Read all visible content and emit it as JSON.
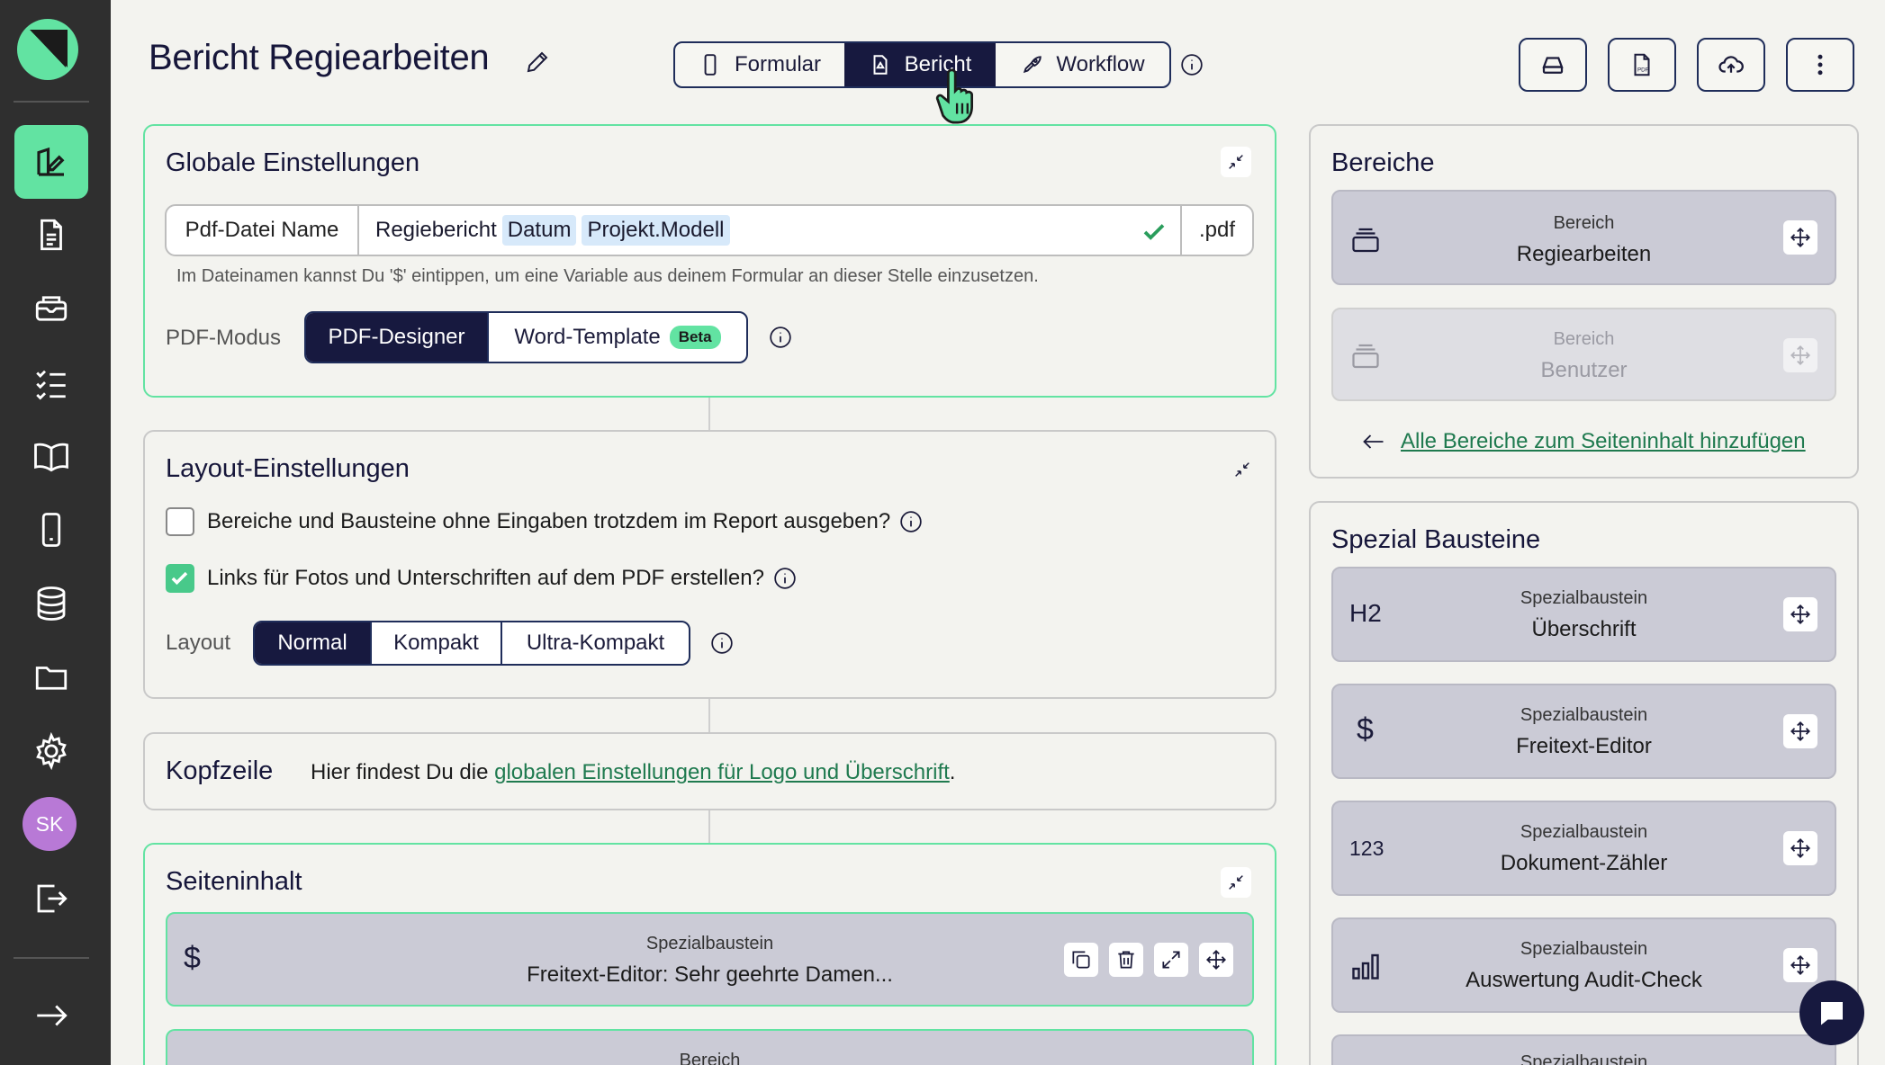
{
  "sidebar": {
    "avatar_initials": "SK",
    "items": [
      {
        "icon": "report-designer-icon",
        "active": true
      },
      {
        "icon": "document-icon"
      },
      {
        "icon": "inbox-icon"
      },
      {
        "icon": "checklist-icon"
      },
      {
        "icon": "book-icon"
      },
      {
        "icon": "phone-icon"
      },
      {
        "icon": "database-icon"
      },
      {
        "icon": "folder-icon"
      },
      {
        "icon": "gear-icon"
      },
      {
        "icon": "logout-icon"
      },
      {
        "icon": "arrow-right-icon"
      }
    ]
  },
  "header": {
    "title": "Bericht Regiearbeiten",
    "tabs": [
      {
        "label": "Formular",
        "icon": "phone-icon"
      },
      {
        "label": "Bericht",
        "icon": "pdf-file-icon",
        "active": true
      },
      {
        "label": "Workflow",
        "icon": "rocket-icon"
      }
    ],
    "actions": [
      "drive-icon",
      "pdf-icon",
      "cloud-upload-icon",
      "more-vertical-icon"
    ]
  },
  "global_settings": {
    "title": "Globale Einstellungen",
    "filename_label": "Pdf-Datei Name",
    "filename_text": "Regiebericht",
    "filename_vars": [
      "Datum",
      "Projekt.Modell"
    ],
    "filename_ext": ".pdf",
    "hint": "Im Dateinamen kannst Du '$' eintippen, um eine Variable aus deinem Formular an dieser Stelle einzusetzen.",
    "pdf_mode_label": "PDF-Modus",
    "pdf_mode_options": [
      "PDF-Designer",
      "Word-Template"
    ],
    "beta_badge": "Beta"
  },
  "layout_settings": {
    "title": "Layout-Einstellungen",
    "option1": "Bereiche und Bausteine ohne Eingaben trotzdem im Report ausgeben?",
    "option1_checked": false,
    "option2": "Links für Fotos und Unterschriften auf dem PDF erstellen?",
    "option2_checked": true,
    "layout_label": "Layout",
    "layout_options": [
      "Normal",
      "Kompakt",
      "Ultra-Kompakt"
    ]
  },
  "header_section": {
    "title": "Kopfzeile",
    "text_before": "Hier findest Du die",
    "link": "globalen Einstellungen für Logo und Überschrift",
    "text_after": "."
  },
  "page_content": {
    "title": "Seiteninhalt",
    "items": [
      {
        "type": "Spezialbaustein",
        "name": "Freitext-Editor: Sehr geehrte Damen...",
        "icon": "$"
      },
      {
        "type": "Bereich",
        "name": ""
      }
    ]
  },
  "areas": {
    "title": "Bereiche",
    "items": [
      {
        "type": "Bereich",
        "name": "Regiearbeiten",
        "disabled": false
      },
      {
        "type": "Bereich",
        "name": "Benutzer",
        "disabled": true
      }
    ],
    "add_all_link": "Alle Bereiche zum Seiteninhalt hinzufügen"
  },
  "special_blocks": {
    "title": "Spezial Bausteine",
    "items": [
      {
        "type": "Spezialbaustein",
        "name": "Überschrift",
        "icon_text": "H2"
      },
      {
        "type": "Spezialbaustein",
        "name": "Freitext-Editor",
        "icon_text": "$"
      },
      {
        "type": "Spezialbaustein",
        "name": "Dokument-Zähler",
        "icon_text": "123"
      },
      {
        "type": "Spezialbaustein",
        "name": "Auswertung Audit-Check",
        "icon_text": ""
      },
      {
        "type": "Spezialbaustein",
        "name": ""
      }
    ]
  },
  "colors": {
    "accent": "#62e3a2",
    "dark": "#17193f",
    "sidebar": "#2f2f2f",
    "avatar": "#b879d6"
  }
}
